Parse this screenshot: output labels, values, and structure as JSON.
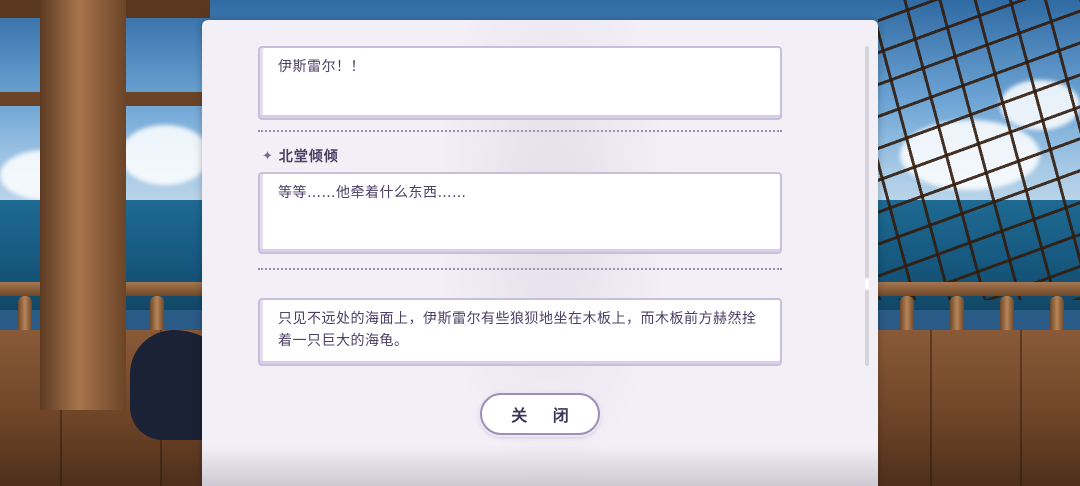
{
  "dialog_log": {
    "entries": [
      {
        "speaker": "",
        "text": "伊斯雷尔！！"
      },
      {
        "speaker": "北堂倾倾",
        "text": "等等……他牵着什么东西……"
      },
      {
        "speaker": "",
        "text": "只见不远处的海面上，伊斯雷尔有些狼狈地坐在木板上，而木板前方赫然拴着一只巨大的海龟。"
      }
    ],
    "speaker_icon": "sparkle-icon",
    "close_label": "关 闭"
  },
  "colors": {
    "panel_bg": "#f2f0f6",
    "bubble_border": "#c8c0da",
    "text": "#4c4066",
    "button_border": "#9c8fb7"
  }
}
